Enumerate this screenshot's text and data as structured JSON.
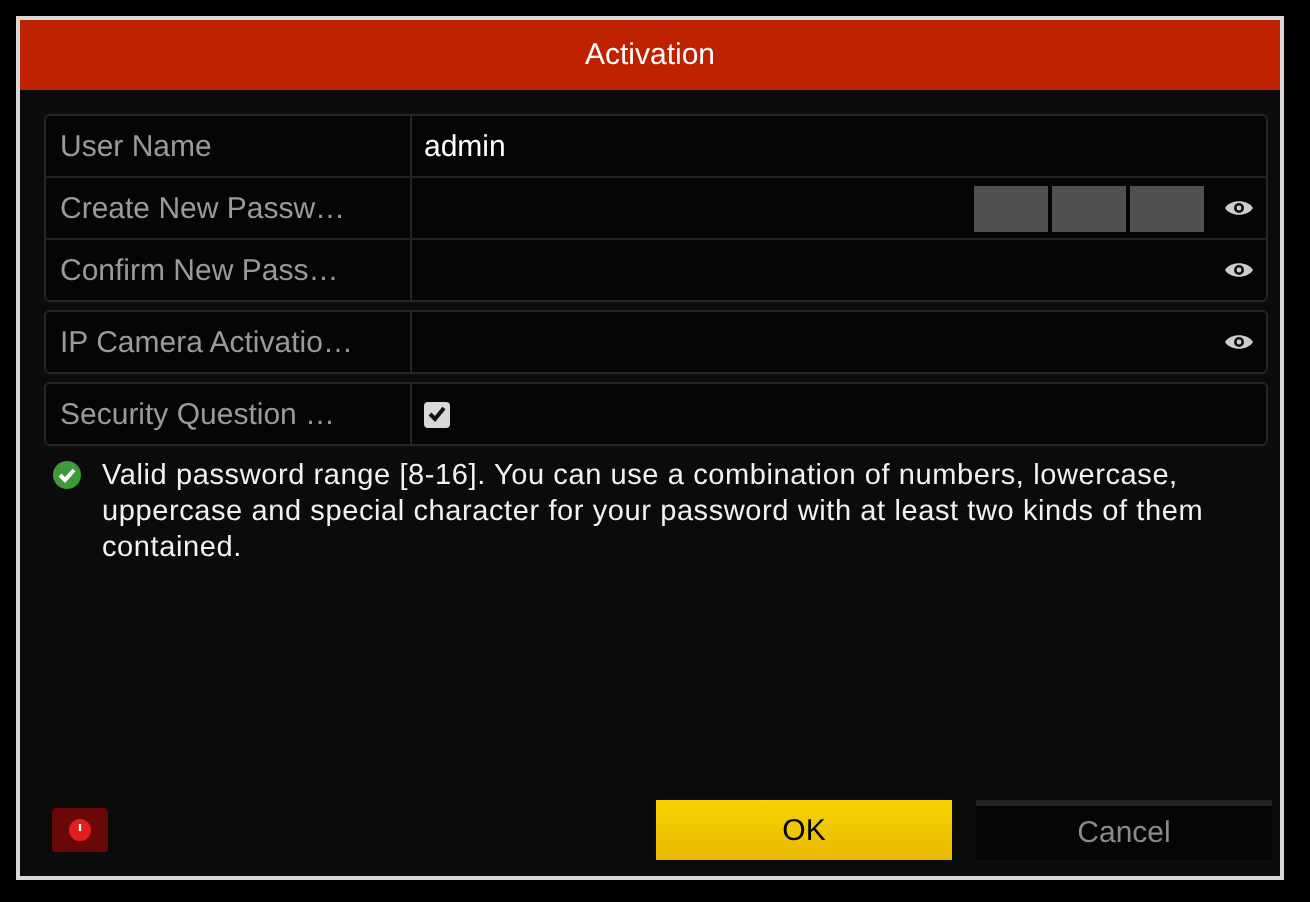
{
  "window": {
    "title": "Activation"
  },
  "field_groups": [
    [
      {
        "kind": "text",
        "label": "User Name",
        "value": "admin"
      },
      {
        "kind": "password",
        "label": "Create New Passw…",
        "strength_meter": true
      },
      {
        "kind": "password",
        "label": "Confirm New Pass…"
      }
    ],
    [
      {
        "kind": "password",
        "label": "IP Camera Activatio…"
      }
    ],
    [
      {
        "kind": "checkbox",
        "label": "Security Question …",
        "checked": true
      }
    ]
  ],
  "hint": "Valid password range [8-16]. You can use a combination of numbers, lowercase, uppercase and special character for your password with at least two kinds of them contained.",
  "buttons": [
    {
      "label": "OK",
      "primary": true
    },
    {
      "label": "Cancel",
      "primary": false
    }
  ]
}
